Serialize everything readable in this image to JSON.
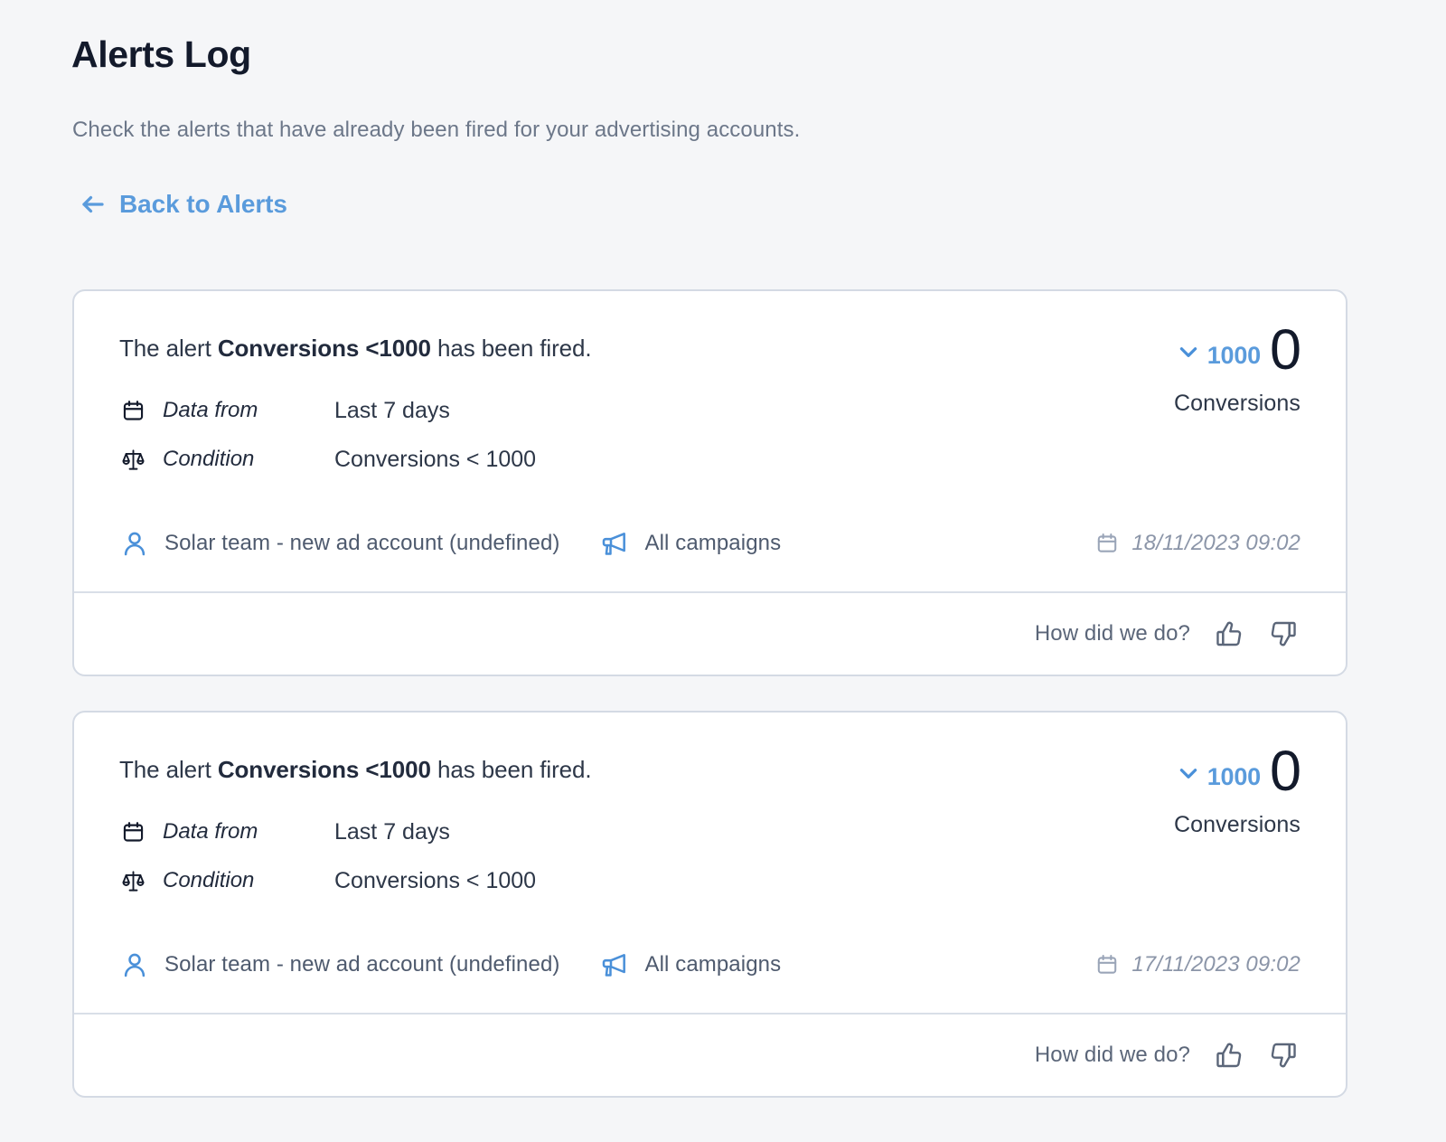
{
  "header": {
    "title": "Alerts Log",
    "subtitle": "Check the alerts that have already been fired for your advertising accounts.",
    "back_link": "Back to Alerts",
    "back_icon": "arrow-left-icon"
  },
  "colors": {
    "page_background": "#f5f6f8",
    "card_background": "#ffffff",
    "card_border": "#d4dae4",
    "accent_blue": "#5a9bdc",
    "title_navy": "#131a2b",
    "muted_gray": "#6c7789",
    "date_gray": "#8b95a8"
  },
  "labels": {
    "data_from": "Data from",
    "condition": "Condition",
    "feedback_question": "How did we do?",
    "thumbs_up_icon": "thumbs-up-icon",
    "thumbs_down_icon": "thumbs-down-icon",
    "calendar_icon": "calendar-icon",
    "scales_icon": "scales-icon",
    "person_icon": "person-icon",
    "megaphone_icon": "megaphone-icon",
    "chevron_down_icon": "chevron-down-icon"
  },
  "alerts": [
    {
      "headline_prefix": "The alert ",
      "headline_name": "Conversions <1000",
      "headline_suffix": " has been fired.",
      "data_from": "Last 7 days",
      "condition": "Conversions < 1000",
      "threshold": "1000",
      "value": "0",
      "unit": "Conversions",
      "account": "Solar team - new ad account (undefined)",
      "campaign": "All campaigns",
      "date": "18/11/2023 09:02"
    },
    {
      "headline_prefix": "The alert ",
      "headline_name": "Conversions <1000",
      "headline_suffix": " has been fired.",
      "data_from": "Last 7 days",
      "condition": "Conversions < 1000",
      "threshold": "1000",
      "value": "0",
      "unit": "Conversions",
      "account": "Solar team - new ad account (undefined)",
      "campaign": "All campaigns",
      "date": "17/11/2023 09:02"
    }
  ]
}
